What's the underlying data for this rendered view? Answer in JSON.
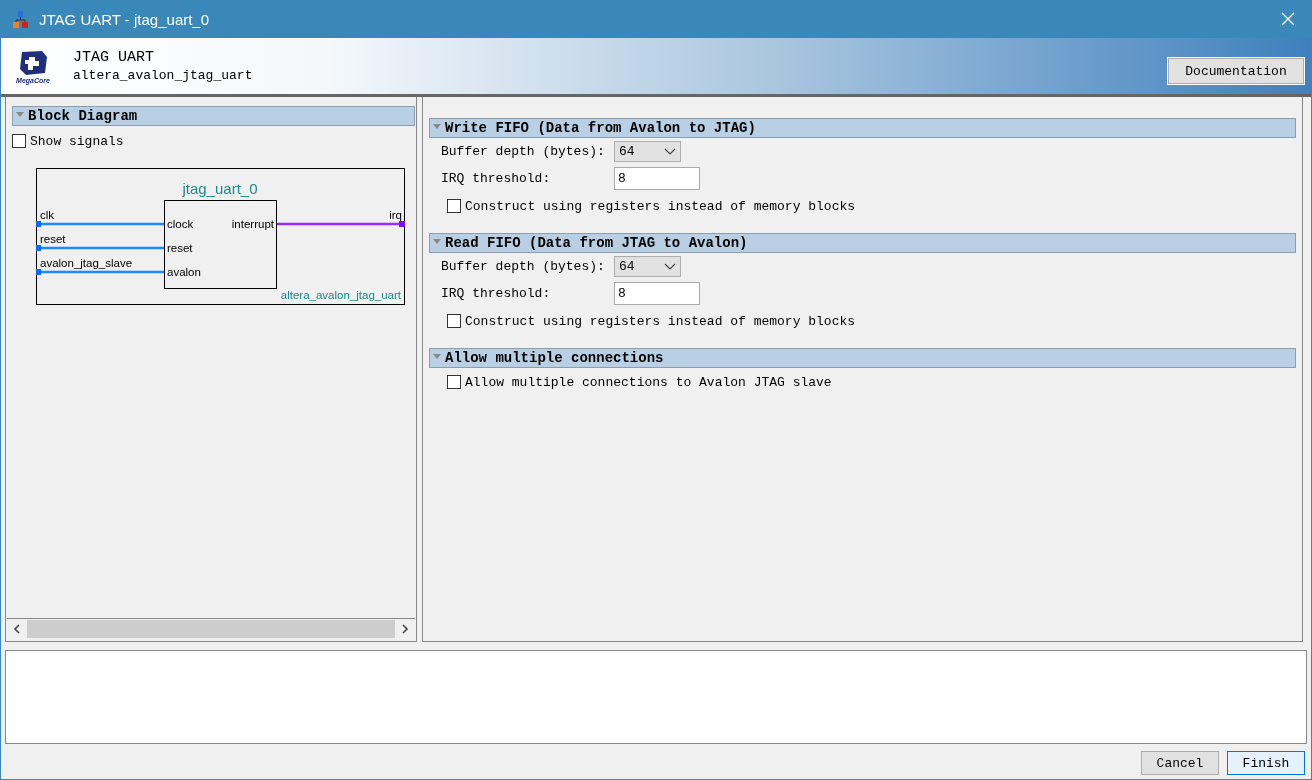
{
  "window": {
    "title": "JTAG UART - jtag_uart_0"
  },
  "header": {
    "logo_text": "MegaCore",
    "title": "JTAG UART",
    "subtitle": "altera_avalon_jtag_uart",
    "documentation_button": "Documentation"
  },
  "left_panel": {
    "section": {
      "title": "Block Diagram",
      "expanded": true
    },
    "show_signals": {
      "label": "Show signals",
      "checked": false
    },
    "diagram": {
      "instance": "jtag_uart_0",
      "module": "altera_avalon_jtag_uart",
      "inputs": [
        {
          "external": "clk",
          "port": "clock"
        },
        {
          "external": "reset",
          "port": "reset"
        },
        {
          "external": "avalon_jtag_slave",
          "port": "avalon"
        }
      ],
      "outputs": [
        {
          "external": "irq",
          "port": "interrupt"
        }
      ]
    }
  },
  "sections": [
    {
      "title": "Write FIFO (Data from Avalon to JTAG)",
      "expanded": true,
      "fields": [
        {
          "kind": "select",
          "label": "Buffer depth (bytes):",
          "value": "64"
        },
        {
          "kind": "input",
          "label": "IRQ threshold:",
          "value": "8"
        },
        {
          "kind": "checkbox",
          "label": "Construct using registers instead of memory blocks",
          "checked": false
        }
      ]
    },
    {
      "title": "Read FIFO (Data from JTAG to Avalon)",
      "expanded": true,
      "fields": [
        {
          "kind": "select",
          "label": "Buffer depth (bytes):",
          "value": "64"
        },
        {
          "kind": "input",
          "label": "IRQ threshold:",
          "value": "8"
        },
        {
          "kind": "checkbox",
          "label": "Construct using registers instead of memory blocks",
          "checked": false
        }
      ]
    },
    {
      "title": "Allow multiple connections",
      "expanded": true,
      "fields": [
        {
          "kind": "checkbox",
          "label": "Allow multiple connections to Avalon JTAG slave",
          "checked": false
        }
      ]
    }
  ],
  "buttons": [
    {
      "label": "Cancel",
      "default": false
    },
    {
      "label": "Finish",
      "default": true
    }
  ]
}
